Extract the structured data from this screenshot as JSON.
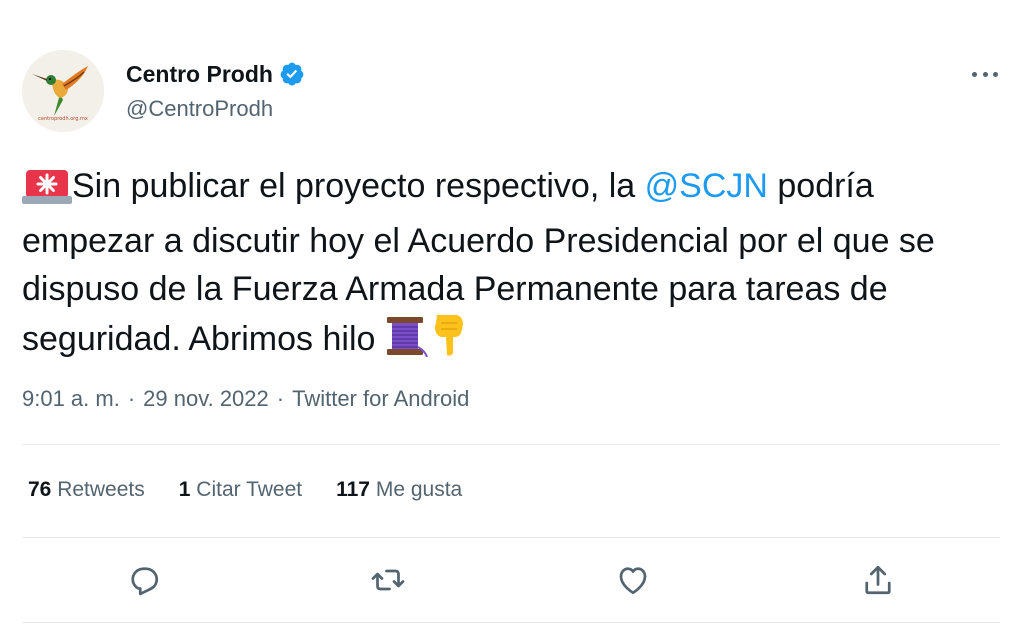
{
  "author": {
    "display_name": "Centro Prodh",
    "handle": "@CentroProdh",
    "verified": true,
    "avatar_caption": "centroprodh.org.mx"
  },
  "tweet": {
    "text_part1": "Sin publicar el proyecto respectivo, la ",
    "mention": "@SCJN",
    "text_part2": " podría empezar a discutir hoy el Acuerdo Presidencial por el que se dispuso de la Fuerza Armada Permanente para tareas de seguridad. Abrimos hilo ",
    "emojis": [
      "rotating-light",
      "thread-spool",
      "pointing-down-hand"
    ]
  },
  "meta": {
    "time": "9:01 a. m.",
    "separator": "·",
    "date": "29 nov. 2022",
    "source": "Twitter for Android"
  },
  "stats": {
    "retweets_count": "76",
    "retweets_label": "Retweets",
    "quotes_count": "1",
    "quotes_label": "Citar Tweet",
    "likes_count": "117",
    "likes_label": "Me gusta"
  },
  "actions": [
    "reply-icon",
    "retweet-icon",
    "like-icon",
    "share-icon"
  ],
  "colors": {
    "accent": "#1d9bf0",
    "text": "#0f1419",
    "secondary": "#536471",
    "divider": "#e6e9eb"
  }
}
